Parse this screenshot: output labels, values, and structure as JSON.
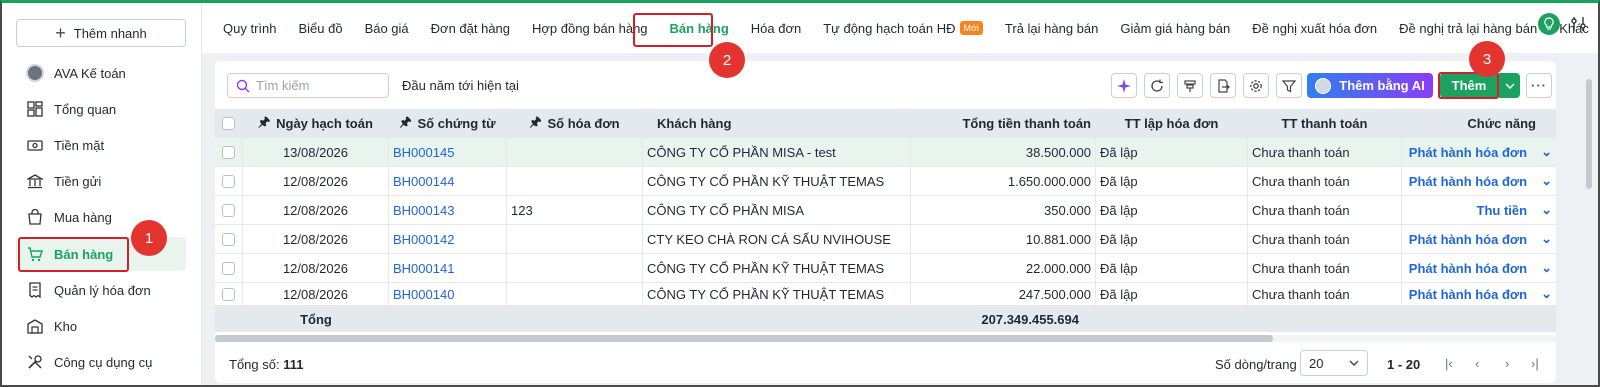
{
  "sidebar": {
    "quick_add": "Thêm nhanh",
    "items": [
      {
        "label": "AVA Kế toán",
        "icon": "ava-avatar-icon"
      },
      {
        "label": "Tổng quan",
        "icon": "dashboard-icon"
      },
      {
        "label": "Tiền mặt",
        "icon": "cash-icon"
      },
      {
        "label": "Tiền gửi",
        "icon": "bank-icon"
      },
      {
        "label": "Mua hàng",
        "icon": "shopping-bag-icon"
      },
      {
        "label": "Bán hàng",
        "icon": "cart-icon"
      },
      {
        "label": "Quản lý hóa đơn",
        "icon": "invoice-icon"
      },
      {
        "label": "Kho",
        "icon": "warehouse-icon"
      },
      {
        "label": "Công cụ dụng cụ",
        "icon": "tools-icon"
      }
    ]
  },
  "tabs": [
    "Quy trình",
    "Biểu đồ",
    "Báo giá",
    "Đơn đặt hàng",
    "Hợp đồng bán hàng",
    "Bán hàng",
    "Hóa đơn",
    "Tự động hạch toán HĐ",
    "Trả lại hàng bán",
    "Giảm giá hàng bán",
    "Đề nghị xuất hóa đơn",
    "Đề nghị trả lại hàng bán",
    "Khác"
  ],
  "tab_new_badge": "Mới",
  "toolbar": {
    "search_placeholder": "Tìm kiếm",
    "date_range": "Đầu năm tới hiện tại",
    "ai_button": "Thêm bằng AI",
    "add_button": "Thêm",
    "more": "···"
  },
  "table": {
    "headers": [
      "Ngày hạch toán",
      "Số chứng từ",
      "Số hóa đơn",
      "Khách hàng",
      "Tổng tiền thanh toán",
      "TT lập hóa đơn",
      "TT thanh toán",
      "Chức năng"
    ],
    "rows": [
      [
        "13/08/2026",
        "BH000145",
        "",
        "CÔNG TY CỔ PHẦN MISA - test",
        "38.500.000",
        "Đã lập",
        "Chưa thanh toán",
        "Phát hành hóa đơn"
      ],
      [
        "12/08/2026",
        "BH000144",
        "",
        "CÔNG TY CỔ PHẦN KỸ THUẬT TEMAS",
        "1.650.000.000",
        "Đã lập",
        "Chưa thanh toán",
        "Phát hành hóa đơn"
      ],
      [
        "12/08/2026",
        "BH000143",
        "123",
        "CÔNG TY CỔ PHẦN MISA",
        "350.000",
        "Đã lập",
        "Chưa thanh toán",
        "Thu tiền"
      ],
      [
        "12/08/2026",
        "BH000142",
        "",
        "CTY KEO CHÀ RON  CÁ SẤU NVIHOUSE",
        "10.881.000",
        "Đã lập",
        "Chưa thanh toán",
        "Phát hành hóa đơn"
      ],
      [
        "12/08/2026",
        "BH000141",
        "",
        "CÔNG TY CỔ PHẦN KỸ THUẬT TEMAS",
        "22.000.000",
        "Đã lập",
        "Chưa thanh toán",
        "Phát hành hóa đơn"
      ],
      [
        "12/08/2026",
        "BH000140",
        "",
        "CÔNG TY CỔ PHẦN KỸ THUẬT TEMAS",
        "247.500.000",
        "Đã lập",
        "Chưa thanh toán",
        "Phát hành hóa đơn"
      ]
    ],
    "total_label": "Tổng",
    "total_value": "207.349.455.694"
  },
  "footer": {
    "total_count_label": "Tổng số:",
    "total_count": "111",
    "page_size_label": "Số dòng/trang",
    "page_size": "20",
    "page_range": "1 - 20"
  },
  "annotations": [
    "1",
    "2",
    "3"
  ],
  "colors": {
    "accent": "#1aa260",
    "link": "#2067d6",
    "annotation": "#d0202a"
  }
}
